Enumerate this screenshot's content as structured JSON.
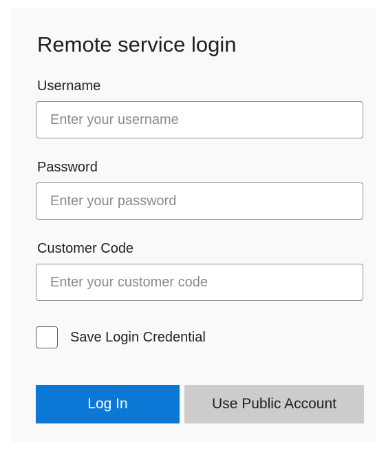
{
  "dialog": {
    "title": "Remote service login"
  },
  "form": {
    "username": {
      "label": "Username",
      "placeholder": "Enter your username",
      "value": ""
    },
    "password": {
      "label": "Password",
      "placeholder": "Enter your password",
      "value": ""
    },
    "customer_code": {
      "label": "Customer Code",
      "placeholder": "Enter your customer code",
      "value": ""
    },
    "save_credential": {
      "label": "Save Login Credential",
      "checked": false
    }
  },
  "buttons": {
    "login_label": "Log In",
    "public_account_label": "Use Public Account"
  },
  "colors": {
    "primary_button": "#0a78d4",
    "secondary_button": "#cccccc",
    "dialog_background": "#f9f9f9"
  }
}
